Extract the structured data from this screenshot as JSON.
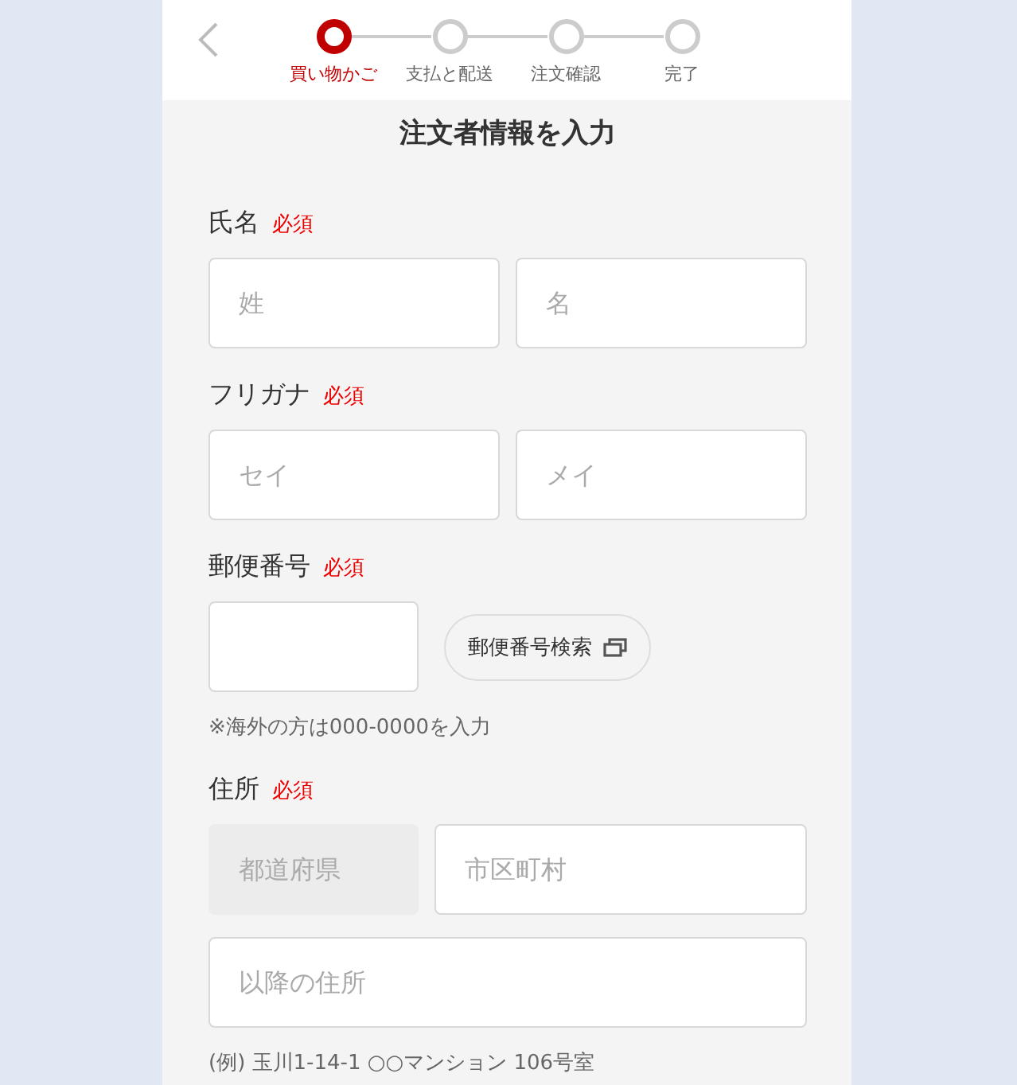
{
  "steps": [
    {
      "label": "買い物かご",
      "selected": true
    },
    {
      "label": "支払と配送",
      "selected": false
    },
    {
      "label": "注文確認",
      "selected": false
    },
    {
      "label": "完了",
      "selected": false
    }
  ],
  "title": "注文者情報を入力",
  "sections": [
    {
      "label": "氏名",
      "required": "必須",
      "rows": [
        [
          {
            "kind": "field",
            "placeholder": "姓",
            "disabled": false
          },
          {
            "kind": "field",
            "placeholder": "名",
            "disabled": false
          }
        ]
      ]
    },
    {
      "label": "フリガナ",
      "required": "必須",
      "rows": [
        [
          {
            "kind": "field",
            "placeholder": "セイ",
            "disabled": false
          },
          {
            "kind": "field",
            "placeholder": "メイ",
            "disabled": false
          }
        ]
      ]
    },
    {
      "label": "郵便番号",
      "required": "必須",
      "rows": [
        [
          {
            "kind": "short-field",
            "disabled": false
          },
          {
            "kind": "button",
            "label": "郵便番号検索"
          }
        ]
      ],
      "note": "※海外の方は000-0000を入力"
    },
    {
      "label": "住所",
      "required": "必須",
      "rows": [
        [
          {
            "kind": "short-field",
            "placeholder": "都道府県",
            "disabled": true
          },
          {
            "kind": "field",
            "placeholder": "市区町村",
            "disabled": false
          }
        ],
        [
          {
            "kind": "field",
            "placeholder": "以降の住所",
            "disabled": false
          }
        ]
      ],
      "note": "(例) 玉川1-14-1 ○○マンション 106号室"
    }
  ]
}
